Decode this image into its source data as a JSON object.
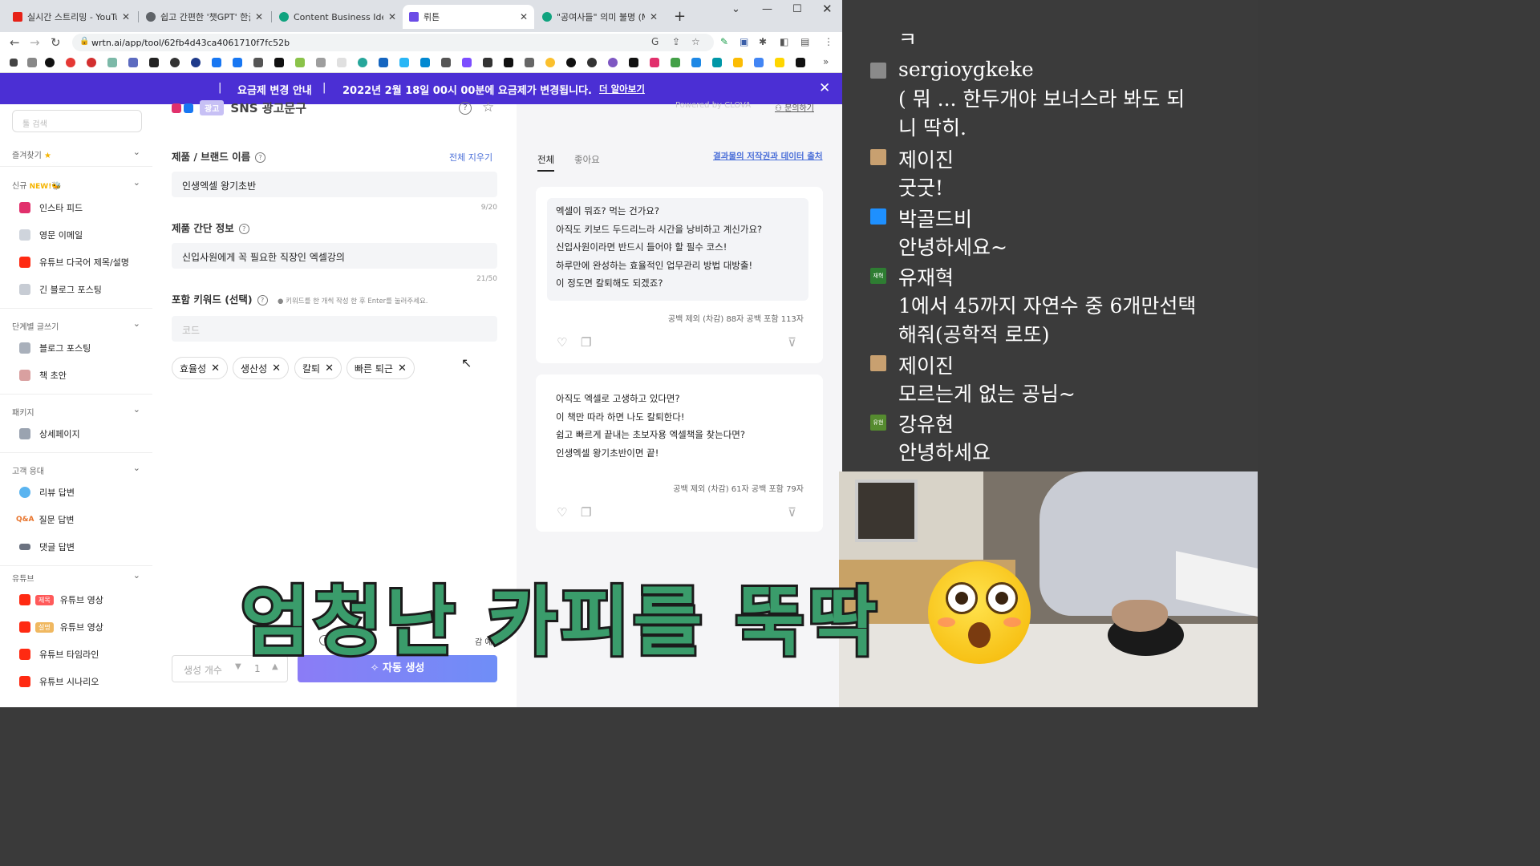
{
  "browser": {
    "tabs": [
      {
        "title": "실시간 스트리밍 - YouTub",
        "color": "#e62117"
      },
      {
        "title": "쉽고 간편한 '챗GPT' 한글",
        "color": "#5f6368"
      },
      {
        "title": "Content Business Ideas",
        "color": "#10a37f"
      },
      {
        "title": "뤼튼",
        "color": "#6b4ce6"
      },
      {
        "title": "\"공여사들\" 의미 불명 (Me",
        "color": "#10a37f"
      }
    ],
    "url": "wrtn.ai/app/tool/62fb4d43ca4061710f7fc52b"
  },
  "banner": {
    "sep": "|",
    "title": "요금제 변경 안내",
    "message": "2022년 2월 18일 00시 00분에 요금제가 변경됩니다.",
    "link": "더 알아보기"
  },
  "sidebar": {
    "search_placeholder": "툴 검색",
    "sections": {
      "favorites": "즐겨찾기",
      "new": "신규",
      "new_badge": "NEW!",
      "steps": "단계별 글쓰기",
      "package": "패키지",
      "support": "고객 응대",
      "youtube": "유튜브"
    },
    "items": {
      "insta": "인스타 피드",
      "english_email": "영문 이메일",
      "yt_multi": "유튜브 다국어 제목/설명",
      "long_blog": "긴 블로그 포스팅",
      "blog": "블로그 포스팅",
      "book": "책 초안",
      "detail": "상세페이지",
      "review": "리뷰 답변",
      "qna": "질문 답변",
      "qna_icon": "Q&A",
      "comment": "댓글 답변",
      "yt_title_badge": "제목",
      "yt_title": "유튜브 영상",
      "yt_desc_badge": "설명",
      "yt_desc": "유튜브 영상",
      "yt_timeline": "유튜브 타임라인",
      "yt_scenario": "유튜브 시나리오"
    }
  },
  "tool": {
    "badge": "광고",
    "title": "SNS 광고문구",
    "powered": "Powered by CLOVA",
    "inquiry": "문의하기",
    "brand_label": "제품 / 브랜드 이름",
    "clear_all": "전체 지우기",
    "brand_value": "인생엑셀 왕기초반",
    "brand_count": "9/20",
    "info_label": "제품 간단 정보",
    "info_value": "신입사원에게 꼭 필요한 직장인 엑셀강의",
    "info_count": "21/50",
    "keyword_label": "포함 키워드 (선택)",
    "keyword_hint": "● 키워드를 한 개씩 작성 한 후 Enter를 눌러주세요.",
    "keyword_placeholder": "코드",
    "keywords": [
      "효율성",
      "생산성",
      "칼퇴",
      "빠른 퇴근"
    ],
    "gen_count_label": "생성 개수",
    "gen_count_value": "1",
    "generate_button": "자동 생성",
    "notice_tail": "감 예정"
  },
  "results": {
    "tab_all": "전체",
    "tab_like": "좋아요",
    "copyright_link": "결과물의 저작권과 데이터 출처",
    "cards": [
      {
        "lines": [
          "엑셀이 뭐죠? 먹는 건가요?",
          "아직도 키보드 두드리느라 시간을 낭비하고 계신가요?",
          "신입사원이라면 반드시 들어야 할 필수 코스!",
          "하루만에 완성하는 효율적인 업무관리 방법 대방출!",
          "이 정도면 칼퇴해도 되겠죠?"
        ],
        "count": "공백 제외 (차감) 88자   공백 포함 113자"
      },
      {
        "lines": [
          "아직도 엑셀로 고생하고 있다면?",
          "이 책만 따라 하면 나도 칼퇴한다!",
          "쉽고 빠르게 끝내는 초보자용 엑셀책을 찾는다면?",
          "인생엑셀 왕기초반이면 끝!"
        ],
        "count": "공백 제외 (차감) 61자   공백 포함 79자"
      }
    ]
  },
  "chat": {
    "messages": [
      {
        "name": "",
        "text": "ㅋ",
        "color": ""
      },
      {
        "name": "sergioygkeke",
        "text": "( 뭐 ... 한두개야 보너스라 봐도 되",
        "text2": "니 딱히.",
        "color": "#8a8a8a"
      },
      {
        "name": "제이진",
        "text": "굿굿!",
        "color": "#c8a070"
      },
      {
        "name": "박골드비",
        "text": "안녕하세요~",
        "color": "#1e90ff"
      },
      {
        "name": "유재혁",
        "text": "1에서 45까지 자연수 중 6개만선택",
        "text2": "해줘(공학적 로또)",
        "color": "#2e7d32",
        "badge": "재혁"
      },
      {
        "name": "제이진",
        "text": "모르는게 없는 공님~",
        "color": "#c8a070"
      },
      {
        "name": "강유현",
        "text": "안녕하세요",
        "color": "#558b2f",
        "badge": "유현"
      }
    ]
  },
  "caption": "엄청난 카피를 뚝딱"
}
